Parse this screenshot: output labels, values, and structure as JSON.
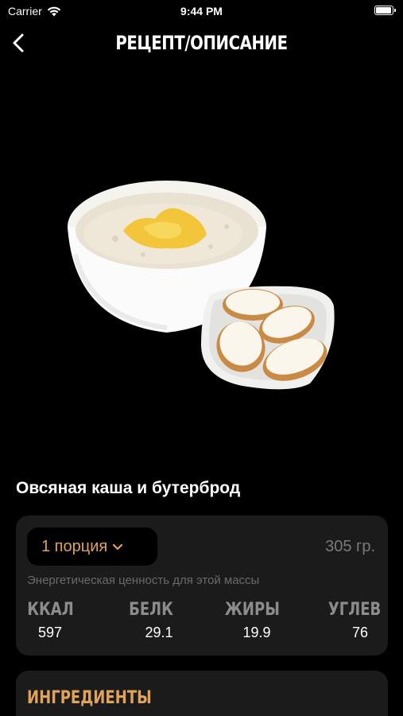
{
  "status": {
    "carrier": "Carrier",
    "time": "9:44 PM",
    "battery_level": 1.0
  },
  "nav": {
    "title": "РЕЦЕПТ/ОПИСАНИЕ"
  },
  "dish": {
    "title": "Овсяная каша и бутерброд"
  },
  "nutrition": {
    "portion_label": "1 порция",
    "weight": "305 гр.",
    "energy_note": "Энергетическая ценность для этой массы",
    "macros": [
      {
        "label": "ККАЛ",
        "value": "597"
      },
      {
        "label": "БЕЛК",
        "value": "29.1"
      },
      {
        "label": "ЖИРЫ",
        "value": "19.9"
      },
      {
        "label": "УГЛЕВ",
        "value": "76"
      }
    ]
  },
  "ingredients": {
    "title": "ИНГРЕДИЕНТЫ"
  },
  "colors": {
    "accent": "#e0a35a",
    "card": "#1b1b1b",
    "background": "#000000"
  }
}
